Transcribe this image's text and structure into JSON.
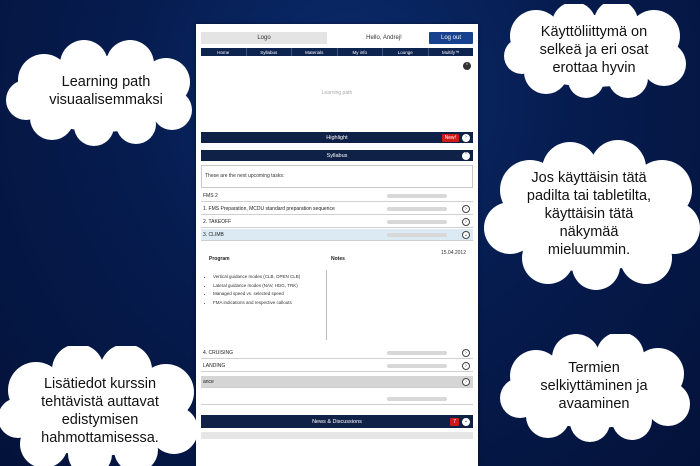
{
  "header": {
    "logo": "Logo",
    "greeting": "Hello, Andrej!",
    "logout_label": "Log out"
  },
  "nav": [
    "Home",
    "Syllabus",
    "Materials",
    "My info",
    "Lounge",
    "Multify™"
  ],
  "learning_path": {
    "label": "Learning path",
    "toggle_icon": "chevron-up-icon"
  },
  "highlight": {
    "label": "Highlight",
    "badge": "New!"
  },
  "syllabus": {
    "label": "Syllabus",
    "intro": "These are the next upcoming tasks:",
    "rows": [
      {
        "label": "FMS 2",
        "progress": 0.55,
        "bar_color": "#58c45c",
        "has_toggle": false
      },
      {
        "label": "1. FMS Preparation, MCDU standard preparation sequence",
        "progress": 0.2,
        "bar_color": "#58c45c",
        "has_toggle": true
      },
      {
        "label": "2. TAKEOFF",
        "progress": 1.0,
        "bar_color": "#e86060",
        "has_toggle": true
      },
      {
        "label": "3. CLIMB",
        "progress": 0.0,
        "bar_color": "#58c45c",
        "has_toggle": true
      }
    ],
    "detail": {
      "date": "15.04.2012",
      "program_title": "Program",
      "notes_title": "Notes",
      "program_items": [
        "Vertical guidance modes (CLB, OPEN CLB)",
        "Lateral guidance modes (NAV, HDG, TRK)",
        "Managed speed vs. selected speed",
        "FMA indications and respective callouts"
      ]
    },
    "more_rows": [
      {
        "label": "4. CRUISING",
        "progress": 0.0,
        "bar_color": "#58c45c"
      },
      {
        "label": "LANDING",
        "progress": 0.0,
        "bar_color": "#58c45c"
      },
      {
        "label": "ance",
        "progress": 0.0,
        "bar_color": "#58c45c"
      },
      {
        "label": "",
        "progress": 0.3,
        "bar_color": "#58c45c"
      }
    ]
  },
  "news": {
    "label": "News & Discussions",
    "count": "7"
  },
  "bubbles": {
    "top_right": [
      "Käyttöliittymä on",
      "selkeä ja  eri osat",
      "erottaa hyvin"
    ],
    "left_top": [
      "Learning path",
      "visuaalisemmaksi"
    ],
    "right_mid": [
      "Jos käyttäisin tätä",
      "padilta tai tabletilta,",
      "käyttäisin tätä",
      "näkymää",
      "mieluummin."
    ],
    "bottom_right": [
      "Termien",
      "selkiyttäminen ja",
      "avaaminen"
    ],
    "bottom_left": [
      "Lisätiedot kurssin",
      "tehtävistä auttavat",
      "edistymisen",
      "hahmottamisessa."
    ]
  }
}
